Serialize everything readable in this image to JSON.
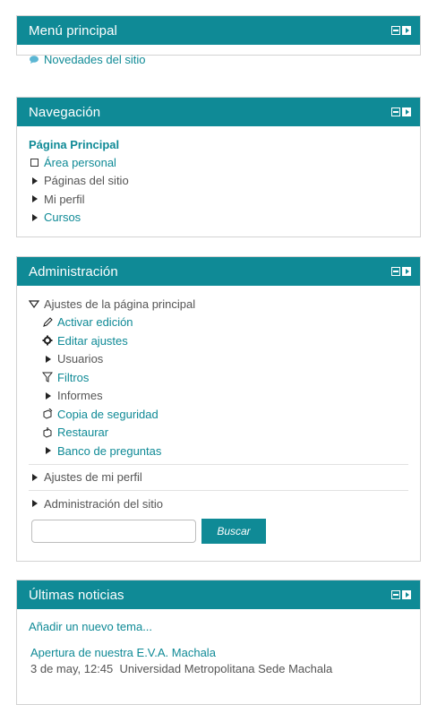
{
  "menu_principal": {
    "title": "Menú principal",
    "items": [
      {
        "label": "Novedades del sitio",
        "icon": "speech-bubble-icon"
      }
    ]
  },
  "navegacion": {
    "title": "Navegación",
    "home": "Página Principal",
    "items": [
      {
        "label": "Área personal",
        "link": true
      },
      {
        "label": "Páginas del sitio",
        "link": false
      },
      {
        "label": "Mi perfil",
        "link": false
      },
      {
        "label": "Cursos",
        "link": true
      }
    ]
  },
  "administracion": {
    "title": "Administración",
    "section": "Ajustes de la página principal",
    "children": [
      {
        "label": "Activar edición",
        "icon": "pencil-icon",
        "link": true
      },
      {
        "label": "Editar ajustes",
        "icon": "gear-icon",
        "link": true
      },
      {
        "label": "Usuarios",
        "icon": "expand-arrow-icon",
        "link": false
      },
      {
        "label": "Filtros",
        "icon": "filter-icon",
        "link": true
      },
      {
        "label": "Informes",
        "icon": "expand-arrow-icon",
        "link": false
      },
      {
        "label": "Copia de seguridad",
        "icon": "backup-icon",
        "link": true
      },
      {
        "label": "Restaurar",
        "icon": "restore-icon",
        "link": true
      },
      {
        "label": "Banco de preguntas",
        "icon": "expand-arrow-icon",
        "link": true
      }
    ],
    "perfil": "Ajustes de mi perfil",
    "sitio": "Administración del sitio",
    "search_placeholder": "",
    "search_button": "Buscar"
  },
  "noticias": {
    "title": "Últimas noticias",
    "add_topic": "Añadir un nuevo tema...",
    "items": [
      {
        "title": "Apertura de nuestra E.V.A. Machala",
        "date": "3 de may, 12:45",
        "author": "Universidad Metropolitana Sede Machala"
      }
    ]
  },
  "colors": {
    "accent": "#0f8a96",
    "text": "#555555",
    "border": "#d3d3d3"
  }
}
